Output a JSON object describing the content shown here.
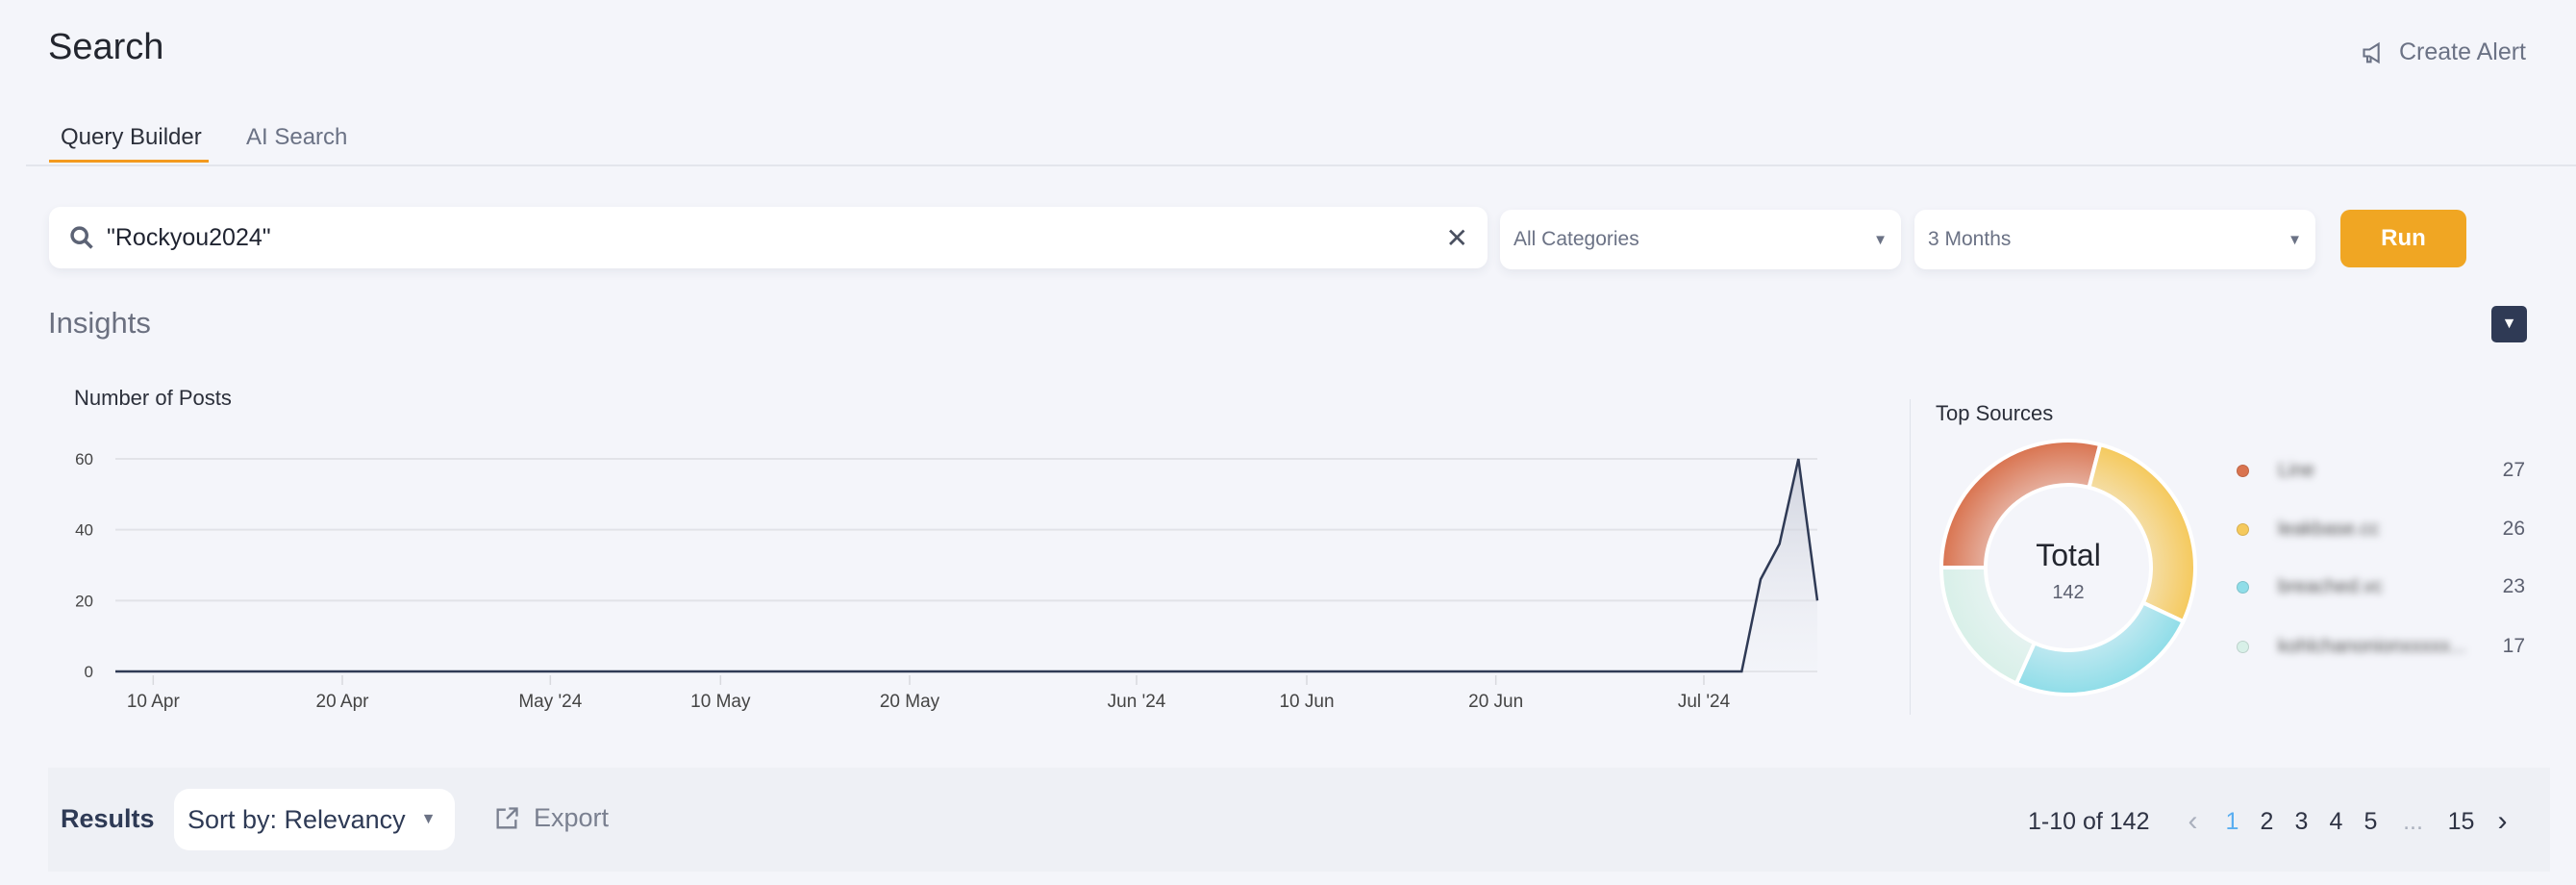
{
  "header": {
    "title": "Search",
    "create_alert": "Create Alert"
  },
  "tabs": [
    {
      "label": "Query Builder",
      "active": true
    },
    {
      "label": "AI Search",
      "active": false
    }
  ],
  "search": {
    "value": "\"Rockyou2024\"",
    "category": "All Categories",
    "range": "3 Months",
    "run": "Run"
  },
  "insights": {
    "title": "Insights"
  },
  "chart_data": [
    {
      "type": "area",
      "title": "Number of Posts",
      "yticks": [
        0,
        20,
        40,
        60
      ],
      "ylim": [
        0,
        60
      ],
      "xlim": [
        "2024-04-08",
        "2024-07-07"
      ],
      "xticks": [
        "10 Apr",
        "20 Apr",
        "May '24",
        "10 May",
        "20 May",
        "Jun '24",
        "10 Jun",
        "20 Jun",
        "Jul '24"
      ],
      "xtick_dates": [
        "2024-04-10",
        "2024-04-20",
        "2024-05-01",
        "2024-05-10",
        "2024-05-20",
        "2024-06-01",
        "2024-06-10",
        "2024-06-20",
        "2024-07-01"
      ],
      "points": [
        {
          "date": "2024-04-08",
          "value": 0
        },
        {
          "date": "2024-07-03",
          "value": 0
        },
        {
          "date": "2024-07-04",
          "value": 26
        },
        {
          "date": "2024-07-05",
          "value": 36
        },
        {
          "date": "2024-07-06",
          "value": 60
        },
        {
          "date": "2024-07-07",
          "value": 20
        }
      ],
      "grid": true,
      "line_color": "#2f3a55"
    },
    {
      "type": "pie",
      "title": "Top Sources",
      "center_label": "Total",
      "center_value": "142",
      "slices": [
        {
          "label": "Line",
          "value": 27,
          "color": "#d9734f"
        },
        {
          "label": "leakbase.cc",
          "value": 26,
          "color": "#f5c95c"
        },
        {
          "label": "breached.vc",
          "value": 23,
          "color": "#8fdde8"
        },
        {
          "label": "kohlchanonionxxxxx...",
          "value": 17,
          "color": "#d8f0e8"
        }
      ]
    }
  ],
  "results": {
    "label": "Results",
    "sort": "Sort by: Relevancy",
    "export": "Export",
    "range_text": "1-10 of 142",
    "pages": [
      "1",
      "2",
      "3",
      "4",
      "5",
      "...",
      "15"
    ],
    "current_page": "1",
    "accent": "#5aaef0"
  }
}
